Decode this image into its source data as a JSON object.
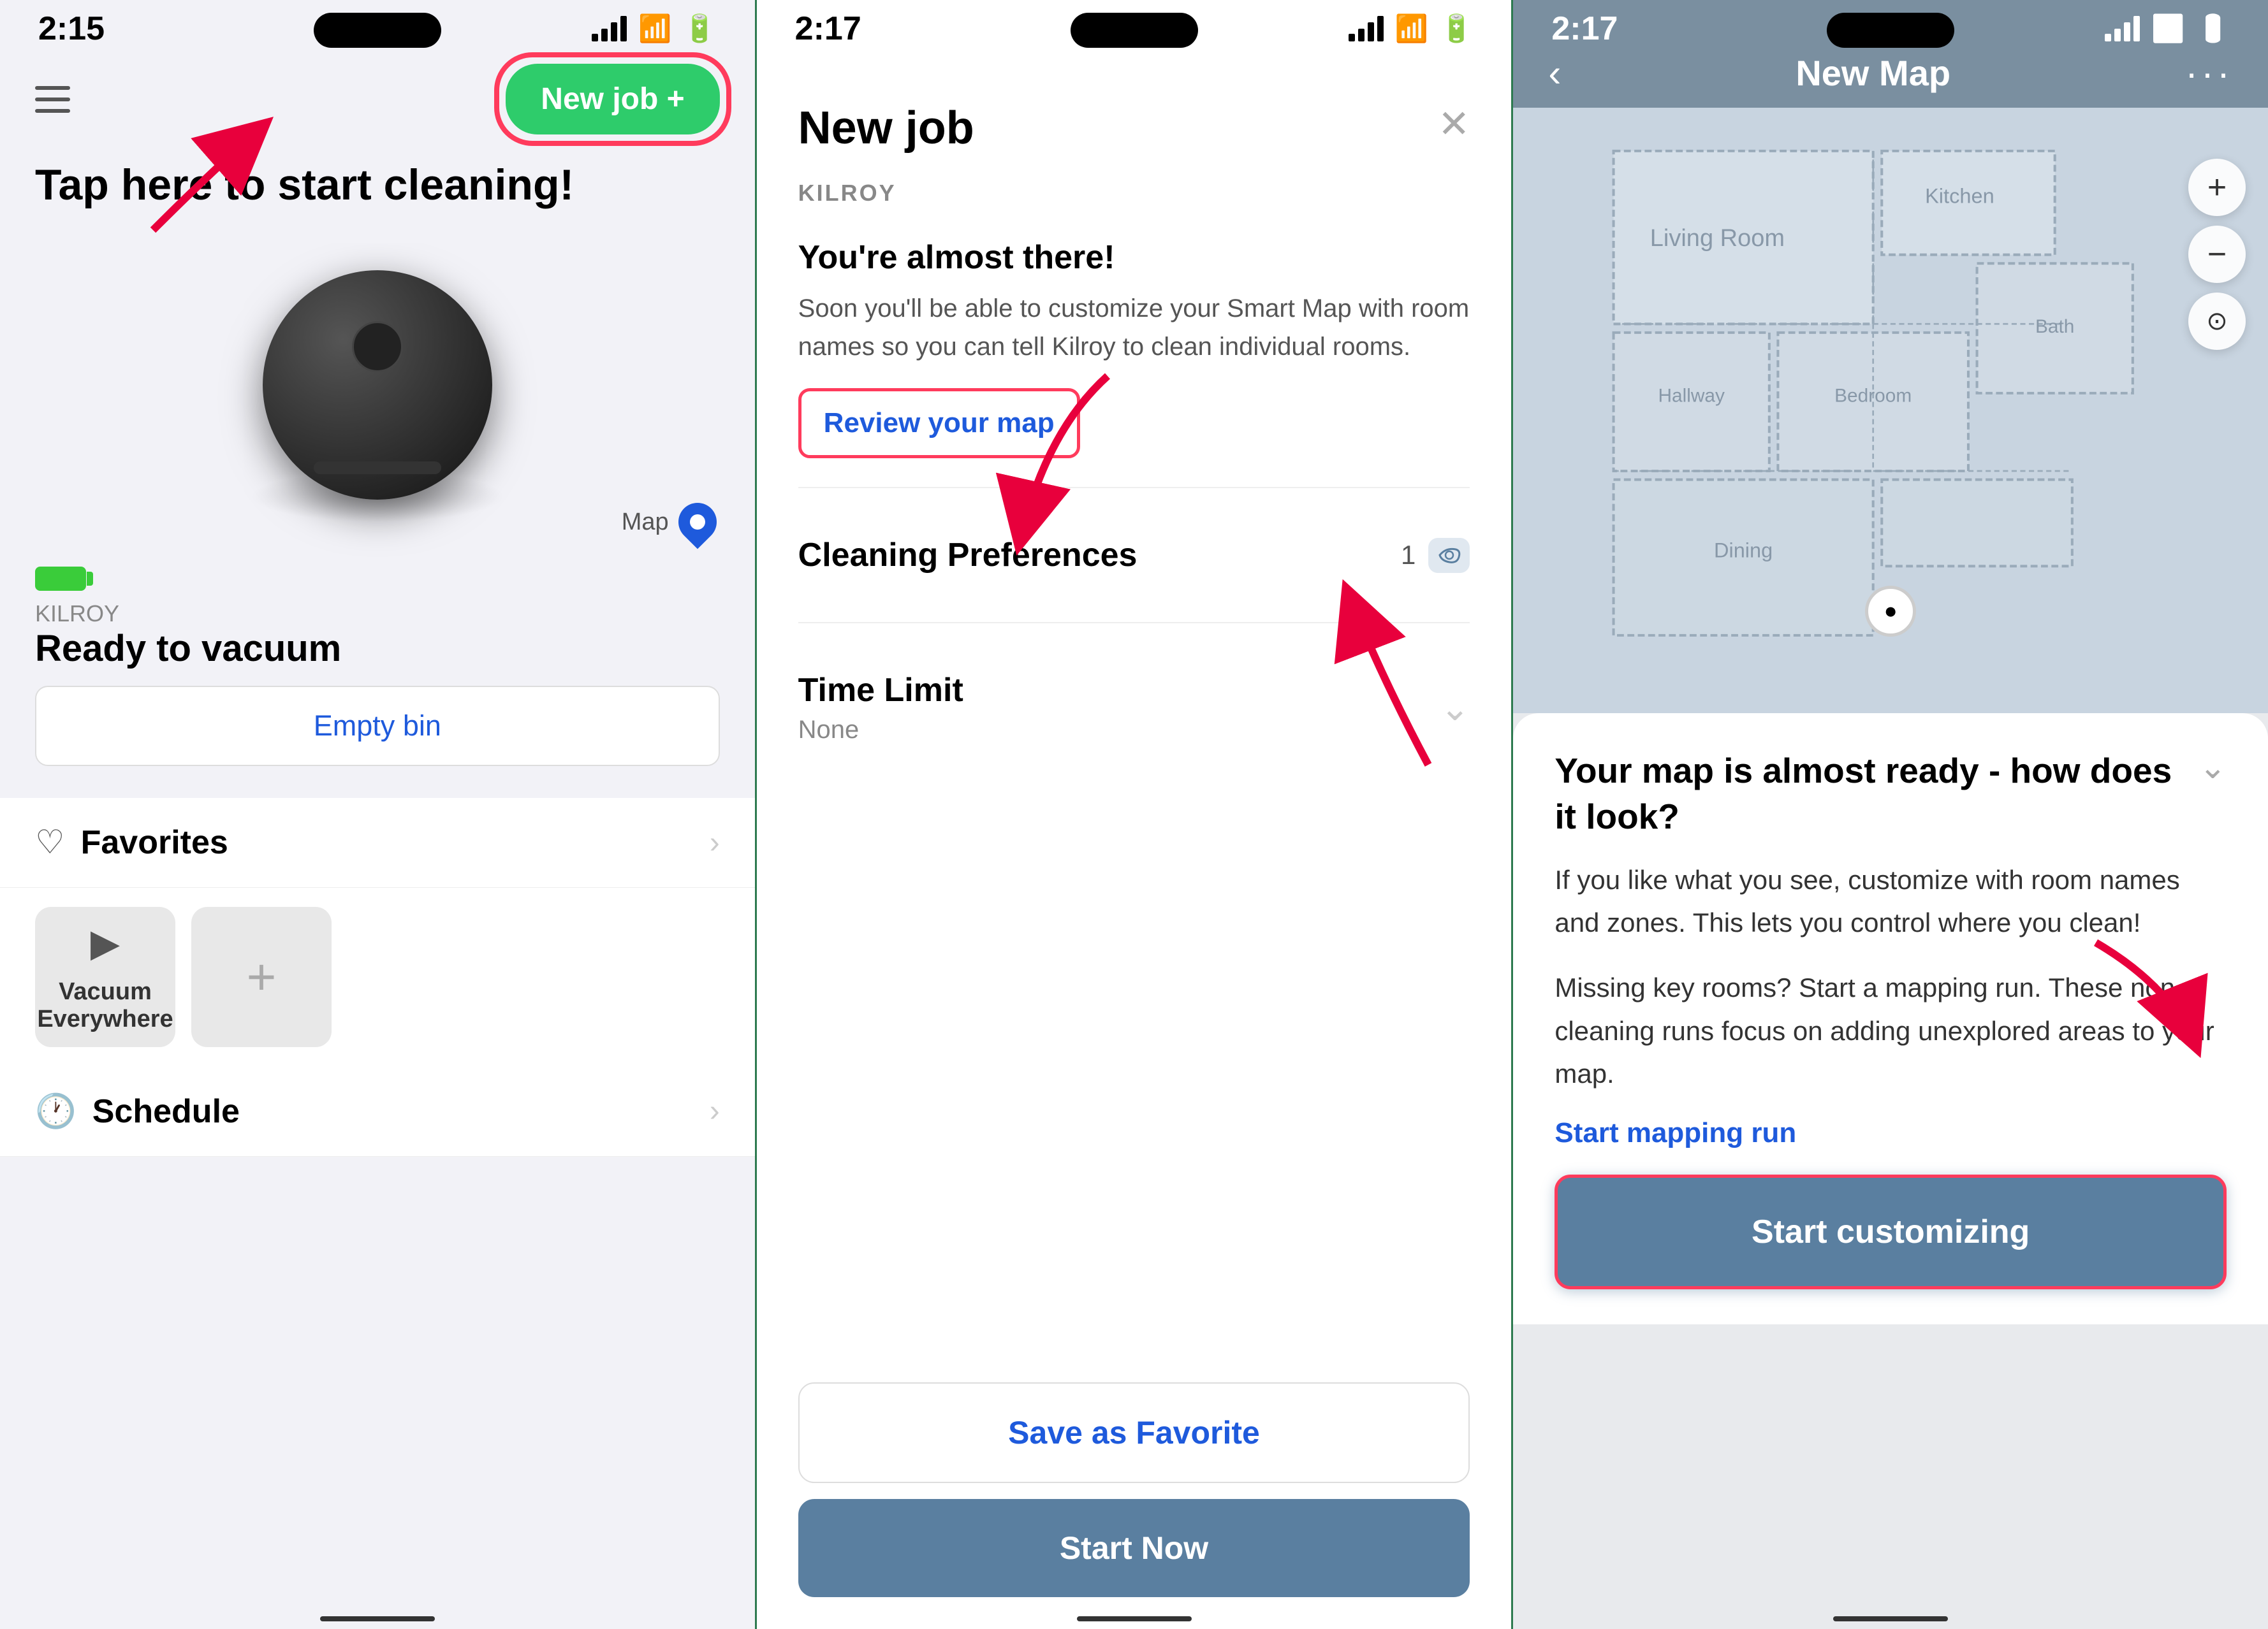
{
  "phone1": {
    "status": {
      "time": "2:15",
      "bg": "light"
    },
    "nav": {
      "new_job_label": "New job +"
    },
    "hero": {
      "tap_text": "Tap here to start cleaning!"
    },
    "device": {
      "name": "KILROY",
      "status": "Ready to vacuum",
      "map_label": "Map"
    },
    "empty_bin": {
      "label": "Empty bin"
    },
    "sections": {
      "favorites_label": "Favorites",
      "schedule_label": "Schedule"
    },
    "favorites": [
      {
        "label": "Vacuum Everywhere",
        "has_play": true
      },
      {
        "label": "+",
        "has_play": false
      }
    ]
  },
  "phone2": {
    "status": {
      "time": "2:17"
    },
    "modal": {
      "title": "New job",
      "device_name": "KILROY",
      "almost_title": "You're almost there!",
      "almost_desc": "Soon you'll be able to customize your Smart Map with room names so you can tell Kilroy to clean individual rooms.",
      "review_map_label": "Review your map",
      "cleaning_pref_label": "Cleaning Preferences",
      "cleaning_pref_value": "1",
      "time_limit_label": "Time Limit",
      "time_limit_value": "None",
      "save_fav_label": "Save as Favorite",
      "start_now_label": "Start Now"
    }
  },
  "phone3": {
    "status": {
      "time": "2:17",
      "bg": "dark"
    },
    "header": {
      "back_label": "‹",
      "title": "New Map",
      "more_label": "···"
    },
    "info": {
      "title": "Your map is almost ready - how does it look?",
      "desc1": "If you like what you see, customize with room names and zones. This lets you control where you clean!",
      "desc2": "Missing key rooms? Start a mapping run. These non-cleaning runs focus on adding unexplored areas to your map.",
      "mapping_link": "Start mapping run",
      "customize_btn": "Start customizing"
    }
  }
}
